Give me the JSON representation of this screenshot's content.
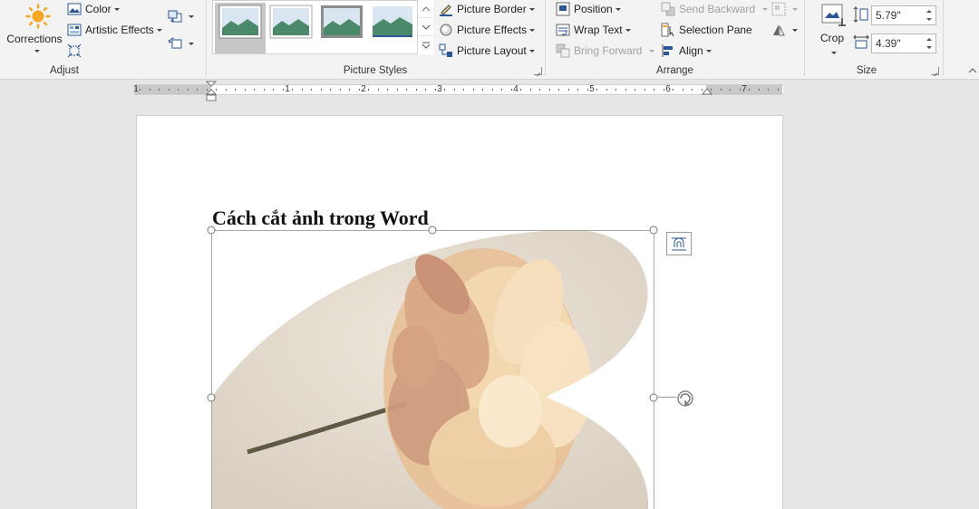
{
  "ribbon": {
    "adjust": {
      "group_label": "Adjust",
      "corrections_label": "Corrections",
      "color_label": "Color",
      "artistic_effects_label": "Artistic Effects"
    },
    "picture_styles": {
      "group_label": "Picture Styles",
      "picture_border_label": "Picture Border",
      "picture_effects_label": "Picture Effects",
      "picture_layout_label": "Picture Layout",
      "selected_style_index": 0
    },
    "arrange": {
      "group_label": "Arrange",
      "position_label": "Position",
      "wrap_text_label": "Wrap Text",
      "bring_forward_label": "Bring Forward",
      "send_backward_label": "Send Backward",
      "selection_pane_label": "Selection Pane",
      "align_label": "Align"
    },
    "size": {
      "group_label": "Size",
      "crop_label": "Crop",
      "height_value": "5.79\"",
      "width_value": "4.39\""
    }
  },
  "ruler": {
    "numbers": [
      "1",
      "1",
      "2",
      "3",
      "4",
      "5",
      "6",
      "7"
    ]
  },
  "document": {
    "heading": "Cách cắt ảnh trong Word"
  },
  "colors": {
    "accent_blue": "#2b5797",
    "sun_orange": "#f5a623",
    "handle_gray": "#777777"
  }
}
